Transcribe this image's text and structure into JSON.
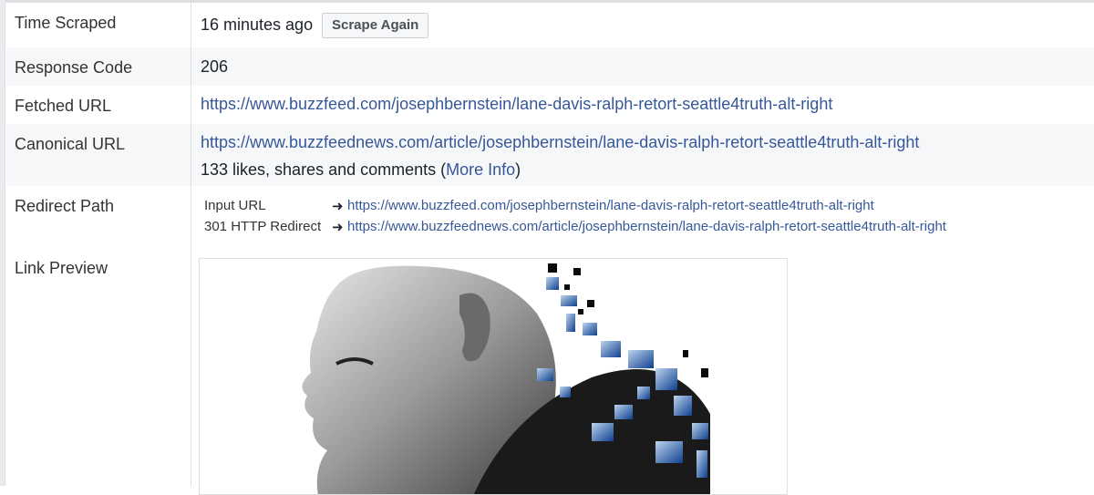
{
  "rows": {
    "time_scraped": {
      "label": "Time Scraped",
      "value": "16 minutes ago",
      "button": "Scrape Again"
    },
    "response_code": {
      "label": "Response Code",
      "value": "206"
    },
    "fetched_url": {
      "label": "Fetched URL",
      "value": "https://www.buzzfeed.com/josephbernstein/lane-davis-ralph-retort-seattle4truth-alt-right"
    },
    "canonical_url": {
      "label": "Canonical URL",
      "value": "https://www.buzzfeednews.com/article/josephbernstein/lane-davis-ralph-retort-seattle4truth-alt-right",
      "engagement_prefix": "133 likes, shares and comments (",
      "more_info": "More Info",
      "engagement_suffix": ")"
    },
    "redirect_path": {
      "label": "Redirect Path",
      "steps": [
        {
          "label": "Input URL",
          "arrow": "➜",
          "url": "https://www.buzzfeed.com/josephbernstein/lane-davis-ralph-retort-seattle4truth-alt-right"
        },
        {
          "label": "301 HTTP Redirect",
          "arrow": "➜",
          "url": "https://www.buzzfeednews.com/article/josephbernstein/lane-davis-ralph-retort-seattle4truth-alt-right"
        }
      ]
    },
    "link_preview": {
      "label": "Link Preview"
    }
  },
  "colors": {
    "link": "#365899",
    "shade": "#f6f7f9",
    "border": "#dddfe2"
  }
}
